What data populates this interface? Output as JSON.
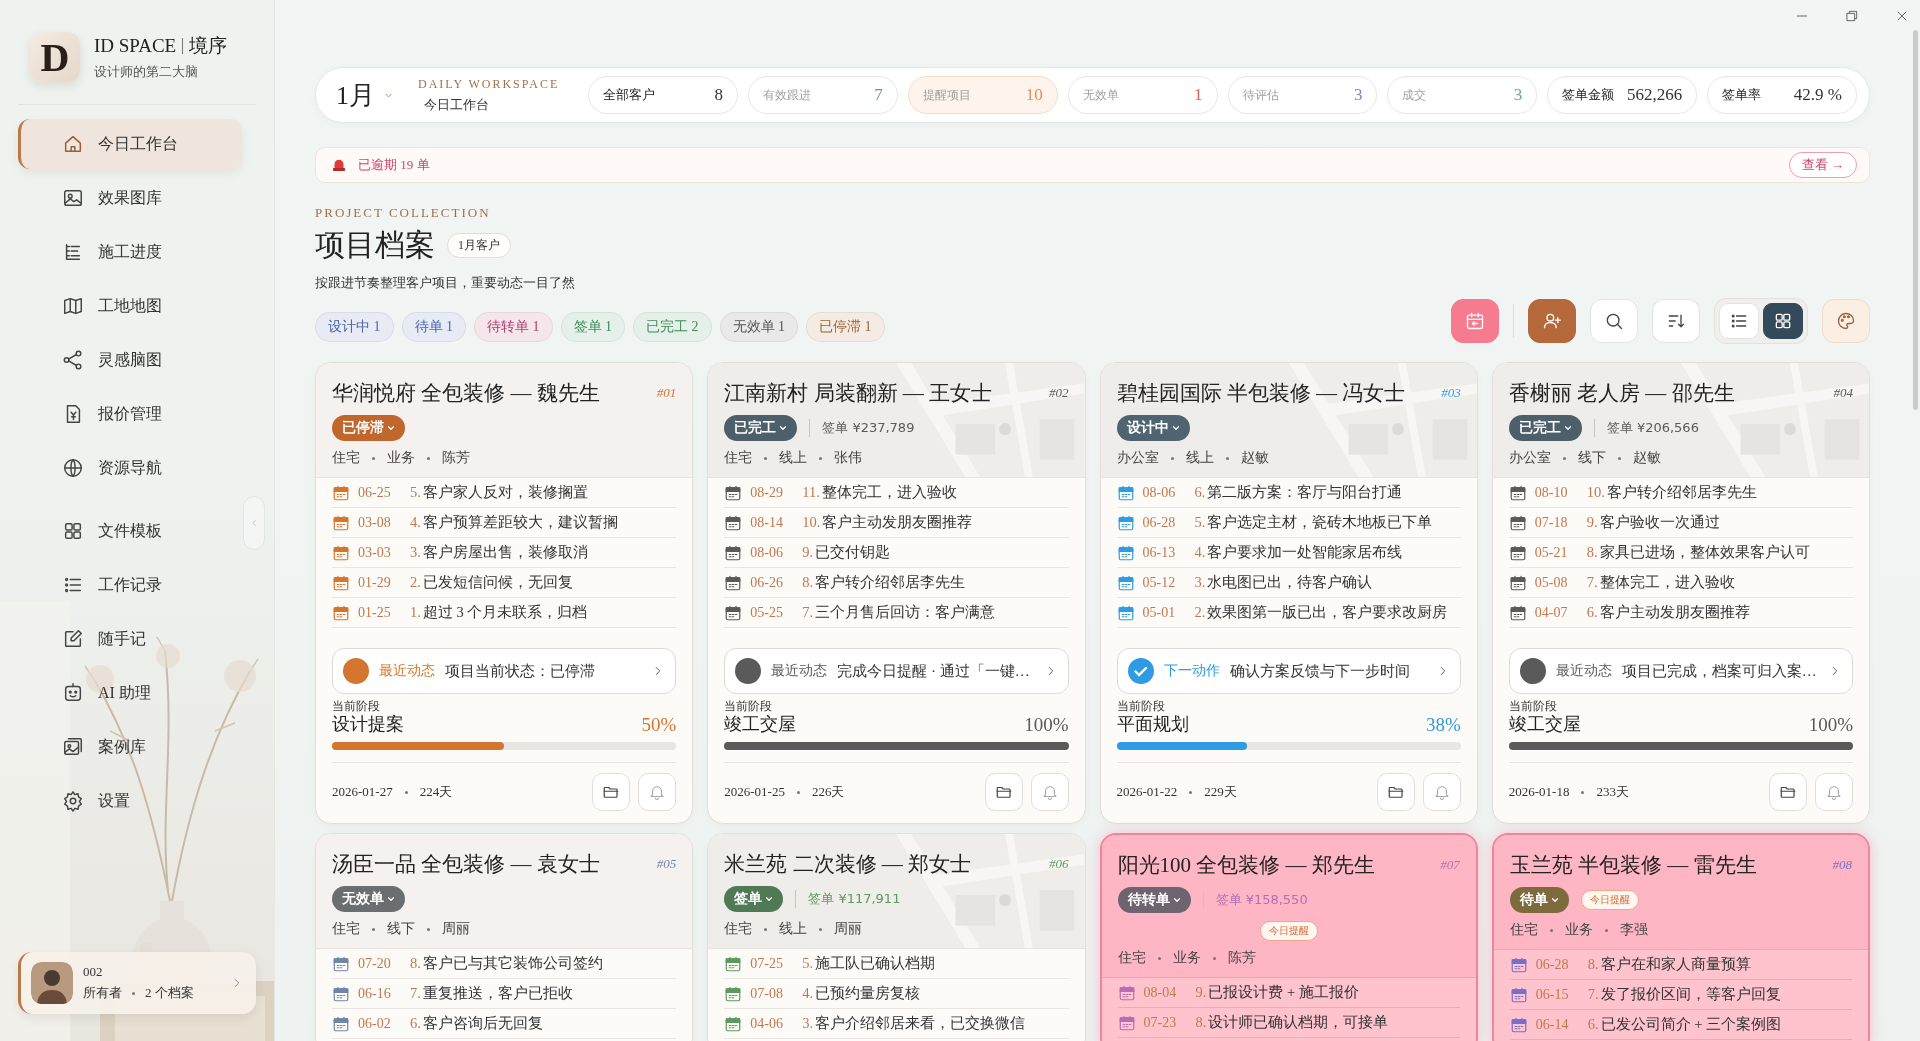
{
  "brand": {
    "mark": "D",
    "name": "ID SPACE",
    "name_cn": "境序",
    "tagline": "设计师的第二大脑"
  },
  "nav_groups": [
    {
      "items": [
        {
          "label": "今日工作台",
          "selected": true
        },
        {
          "label": "效果图库",
          "selected": false
        },
        {
          "label": "施工进度",
          "selected": false
        },
        {
          "label": "工地地图",
          "selected": false
        },
        {
          "label": "灵感脑图",
          "selected": false
        },
        {
          "label": "报价管理",
          "selected": false
        },
        {
          "label": "资源导航",
          "selected": false
        }
      ]
    },
    {
      "items": [
        {
          "label": "文件模板",
          "selected": false
        },
        {
          "label": "工作记录",
          "selected": false
        },
        {
          "label": "随手记",
          "selected": false
        },
        {
          "label": "AI 助理",
          "selected": false
        },
        {
          "label": "案例库",
          "selected": false
        },
        {
          "label": "设置",
          "selected": false
        }
      ]
    }
  ],
  "user": {
    "name": "002",
    "role": "所有者",
    "count": "2 个档案"
  },
  "header": {
    "month": "1月",
    "eyebrow": "DAILY WORKSPACE",
    "subtitle": "今日工作台"
  },
  "stats": [
    {
      "kind": "total",
      "label": "全部客户",
      "value": "8",
      "color": "#333333"
    },
    {
      "kind": "status",
      "label": "有效跟进",
      "value": "7",
      "color": "#6a8fd0"
    },
    {
      "kind": "alert",
      "label": "提醒项目",
      "value": "10",
      "color": "#e0905a"
    },
    {
      "kind": "status",
      "label": "无效单",
      "value": "1",
      "color": "#e06060"
    },
    {
      "kind": "status",
      "label": "待评估",
      "value": "3",
      "color": "#8a7fd0"
    },
    {
      "kind": "status",
      "label": "成交",
      "value": "3",
      "color": "#5fb07a"
    },
    {
      "kind": "total",
      "label": "签单金额",
      "value": "562,266",
      "color": "#333333"
    },
    {
      "kind": "total",
      "label": "签单率",
      "value": "42.9 %",
      "color": "#333333"
    }
  ],
  "overdue": {
    "text": "已逾期 19 单",
    "action": "查看 →"
  },
  "section": {
    "eyebrow": "PROJECT COLLECTION",
    "title": "项目档案",
    "badge": "1月客户",
    "description": "按跟进节奏整理客户项目，重要动态一目了然"
  },
  "filters": [
    {
      "label": "设计中 1",
      "color": "#4f63a8"
    },
    {
      "label": "待单 1",
      "color": "#4a64b0"
    },
    {
      "label": "待转单 1",
      "color": "#b0406e"
    },
    {
      "label": "签单 1",
      "color": "#3e8a5a"
    },
    {
      "label": "已完工 2",
      "color": "#3e8a5a"
    },
    {
      "label": "无效单 1",
      "color": "#555555"
    },
    {
      "label": "已停滞 1",
      "color": "#a0622e"
    }
  ],
  "view_toggle": [
    {
      "kind": "list",
      "selected": false
    },
    {
      "kind": "grid",
      "selected": true
    }
  ],
  "cards": [
    {
      "title": "华润悦府 全包装修 — 魏先生",
      "number": "#01",
      "color": "#d4762f",
      "highlighted": false,
      "map": false,
      "status": {
        "label": "已停滞",
        "color": "#c0672e"
      },
      "meta": [
        "住宅",
        "业务",
        "陈芳"
      ],
      "entries": [
        {
          "date": "06-25",
          "index": "5.",
          "text": "客户家人反对，装修搁置"
        },
        {
          "date": "03-08",
          "index": "4.",
          "text": "客户预算差距较大，建议暂搁"
        },
        {
          "date": "03-03",
          "index": "3.",
          "text": "客户房屋出售，装修取消"
        },
        {
          "date": "01-29",
          "index": "2.",
          "text": "已发短信问候，无回复"
        },
        {
          "date": "01-25",
          "index": "1.",
          "text": "超过 3 个月未联系，归档"
        }
      ],
      "activity": {
        "kind": "recent",
        "label": "最近动态",
        "text": "项目当前状态：已停滞"
      },
      "stage": {
        "caption": "当前阶段",
        "name": "设计提案",
        "percent": "50%",
        "level": 0.5
      },
      "footer": {
        "date": "2026-01-27",
        "days": "224天"
      }
    },
    {
      "title": "江南新村 局装翻新 — 王女士",
      "number": "#02",
      "color": "#5a5a5a",
      "highlighted": false,
      "map": true,
      "status": {
        "label": "已完工",
        "color": "#4d5f6b"
      },
      "signed": "签单 ¥237,789",
      "meta": [
        "住宅",
        "线上",
        "张伟"
      ],
      "entries": [
        {
          "date": "08-29",
          "index": "11.",
          "text": "整体完工，进入验收"
        },
        {
          "date": "08-14",
          "index": "10.",
          "text": "客户主动发朋友圈推荐"
        },
        {
          "date": "08-06",
          "index": "9.",
          "text": "已交付钥匙"
        },
        {
          "date": "06-26",
          "index": "8.",
          "text": "客户转介绍邻居李先生"
        },
        {
          "date": "05-25",
          "index": "7.",
          "text": "三个月售后回访：客户满意"
        }
      ],
      "activity": {
        "kind": "recent",
        "label": "最近动态",
        "text": "完成今日提醒 · 通过「一键…"
      },
      "stage": {
        "caption": "当前阶段",
        "name": "竣工交屋",
        "percent": "100%",
        "level": 1
      },
      "footer": {
        "date": "2026-01-25",
        "days": "226天"
      }
    },
    {
      "title": "碧桂园国际 半包装修 — 冯女士",
      "number": "#03",
      "color": "#2f9be3",
      "highlighted": false,
      "map": true,
      "status": {
        "label": "设计中",
        "color": "#4f6470"
      },
      "meta": [
        "办公室",
        "线上",
        "赵敏"
      ],
      "entries": [
        {
          "date": "08-06",
          "index": "6.",
          "text": "第二版方案：客厅与阳台打通"
        },
        {
          "date": "06-28",
          "index": "5.",
          "text": "客户选定主材，瓷砖木地板已下单"
        },
        {
          "date": "06-13",
          "index": "4.",
          "text": "客户要求加一处智能家居布线"
        },
        {
          "date": "05-12",
          "index": "3.",
          "text": "水电图已出，待客户确认"
        },
        {
          "date": "05-01",
          "index": "2.",
          "text": "效果图第一版已出，客户要求改厨房"
        }
      ],
      "activity": {
        "kind": "next",
        "label": "下一动作",
        "text": "确认方案反馈与下一步时间"
      },
      "stage": {
        "caption": "当前阶段",
        "name": "平面规划",
        "percent": "38%",
        "level": 0.38
      },
      "footer": {
        "date": "2026-01-22",
        "days": "229天"
      }
    },
    {
      "title": "香榭丽 老人房 — 邵先生",
      "number": "#04",
      "color": "#5a5a5a",
      "highlighted": false,
      "map": true,
      "status": {
        "label": "已完工",
        "color": "#4d5f6b"
      },
      "signed": "签单 ¥206,566",
      "meta": [
        "办公室",
        "线下",
        "赵敏"
      ],
      "entries": [
        {
          "date": "08-10",
          "index": "10.",
          "text": "客户转介绍邻居李先生"
        },
        {
          "date": "07-18",
          "index": "9.",
          "text": "客户验收一次通过"
        },
        {
          "date": "05-21",
          "index": "8.",
          "text": "家具已进场，整体效果客户认可"
        },
        {
          "date": "05-08",
          "index": "7.",
          "text": "整体完工，进入验收"
        },
        {
          "date": "04-07",
          "index": "6.",
          "text": "客户主动发朋友圈推荐"
        }
      ],
      "activity": {
        "kind": "recent",
        "label": "最近动态",
        "text": "项目已完成，档案可归入案…"
      },
      "stage": {
        "caption": "当前阶段",
        "name": "竣工交屋",
        "percent": "100%",
        "level": 1
      },
      "footer": {
        "date": "2026-01-18",
        "days": "233天"
      }
    },
    {
      "title": "汤臣一品 全包装修 — 袁女士",
      "number": "#05",
      "color": "#6f86a8",
      "highlighted": false,
      "map": false,
      "status": {
        "label": "无效单",
        "color": "#6b6e70"
      },
      "meta": [
        "住宅",
        "线下",
        "周丽"
      ],
      "entries": [
        {
          "date": "07-20",
          "index": "8.",
          "text": "客户已与其它装饰公司签约"
        },
        {
          "date": "06-16",
          "index": "7.",
          "text": "重复推送，客户已拒收"
        },
        {
          "date": "06-02",
          "index": "6.",
          "text": "客户咨询后无回复"
        }
      ]
    },
    {
      "title": "米兰苑 二次装修 — 郑女士",
      "number": "#06",
      "color": "#5c9a5f",
      "highlighted": false,
      "map": true,
      "status": {
        "label": "签单",
        "color": "#4f7a55"
      },
      "signed": "签单 ¥117,911",
      "meta": [
        "住宅",
        "线上",
        "周丽"
      ],
      "entries": [
        {
          "date": "07-25",
          "index": "5.",
          "text": "施工队已确认档期"
        },
        {
          "date": "07-08",
          "index": "4.",
          "text": "已预约量房复核"
        },
        {
          "date": "04-06",
          "index": "3.",
          "text": "客户介绍邻居来看，已交换微信"
        }
      ]
    },
    {
      "title": "阳光100 全包装修 — 郑先生",
      "number": "#07",
      "color": "#b46fb4",
      "highlighted": true,
      "map": false,
      "status": {
        "label": "待转单",
        "color": "#6d6470"
      },
      "signed": "签单 ¥158,550",
      "reminder": "今日提醒",
      "meta": [
        "住宅",
        "业务",
        "陈芳"
      ],
      "entries": [
        {
          "date": "08-04",
          "index": "9.",
          "text": "已报设计费 + 施工报价"
        },
        {
          "date": "07-23",
          "index": "8.",
          "text": "设计师已确认档期，可接单"
        }
      ]
    },
    {
      "title": "玉兰苑 半包装修 — 雷先生",
      "number": "#08",
      "color": "#7a6fc8",
      "highlighted": true,
      "map": false,
      "status": {
        "label": "待单",
        "color": "#7d6a3d"
      },
      "reminder": "今日提醒",
      "meta": [
        "住宅",
        "业务",
        "李强"
      ],
      "entries": [
        {
          "date": "06-28",
          "index": "8.",
          "text": "客户在和家人商量预算"
        },
        {
          "date": "06-15",
          "index": "7.",
          "text": "发了报价区间，等客户回复"
        },
        {
          "date": "06-14",
          "index": "6.",
          "text": "已发公司简介 + 三个案例图"
        }
      ]
    }
  ]
}
